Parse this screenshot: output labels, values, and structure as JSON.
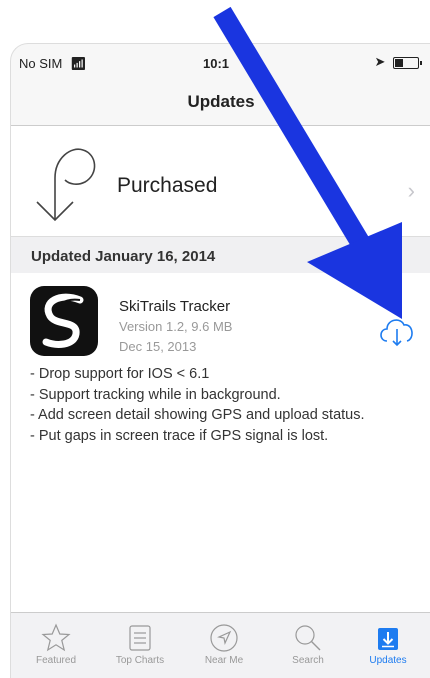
{
  "status_bar": {
    "carrier": "No SIM",
    "time": "10:1"
  },
  "nav": {
    "title": "Updates"
  },
  "purchased": {
    "label": "Purchased"
  },
  "section": {
    "header": "Updated January 16, 2014"
  },
  "app": {
    "name": "SkiTrails Tracker",
    "version_size": "Version 1.2, 9.6 MB",
    "date": "Dec 15, 2013",
    "release_notes": [
      "- Drop support for IOS < 6.1",
      "- Support tracking while in background.",
      "- Add screen detail showing GPS and upload status.",
      "- Put gaps in screen trace if GPS signal is lost."
    ]
  },
  "tabs": [
    {
      "label": "Featured",
      "icon": "star-icon"
    },
    {
      "label": "Top Charts",
      "icon": "list-icon"
    },
    {
      "label": "Near Me",
      "icon": "location-icon"
    },
    {
      "label": "Search",
      "icon": "search-icon"
    },
    {
      "label": "Updates",
      "icon": "updates-icon"
    }
  ],
  "colors": {
    "accent": "#1e7cf0",
    "arrow": "#1a35e0"
  }
}
